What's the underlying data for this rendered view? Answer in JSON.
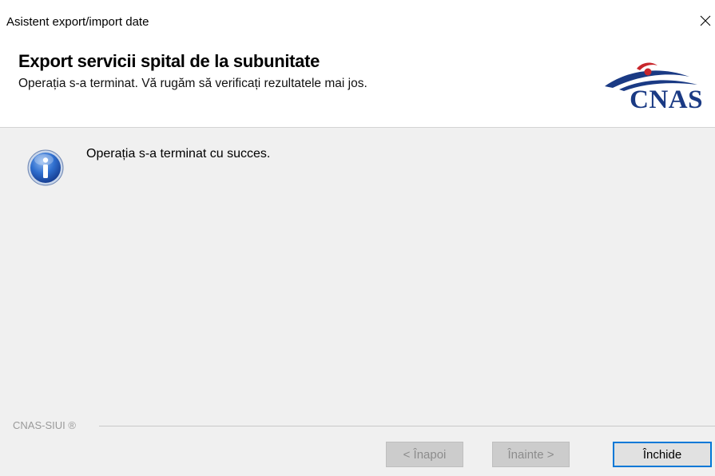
{
  "window": {
    "title": "Asistent export/import date",
    "close_glyph": "×"
  },
  "header": {
    "title": "Export servicii spital de la subunitate",
    "subtitle": "Operația s-a terminat. Vă rugăm să verificați rezultatele mai jos.",
    "logo_text": "CNAS",
    "logo_color": "#1a3a84",
    "logo_accent_color": "#c8262c"
  },
  "content": {
    "icon": "info-icon",
    "message": "Operația s-a terminat cu succes."
  },
  "footer": {
    "brand": "CNAS-SIUI ®",
    "buttons": {
      "back_label": "< Înapoi",
      "next_label": "Înainte >",
      "close_label": "Închide"
    }
  },
  "colors": {
    "focus_border": "#0078d7",
    "panel_background": "#f0f0f0",
    "disabled_text": "#8c8c8c"
  }
}
